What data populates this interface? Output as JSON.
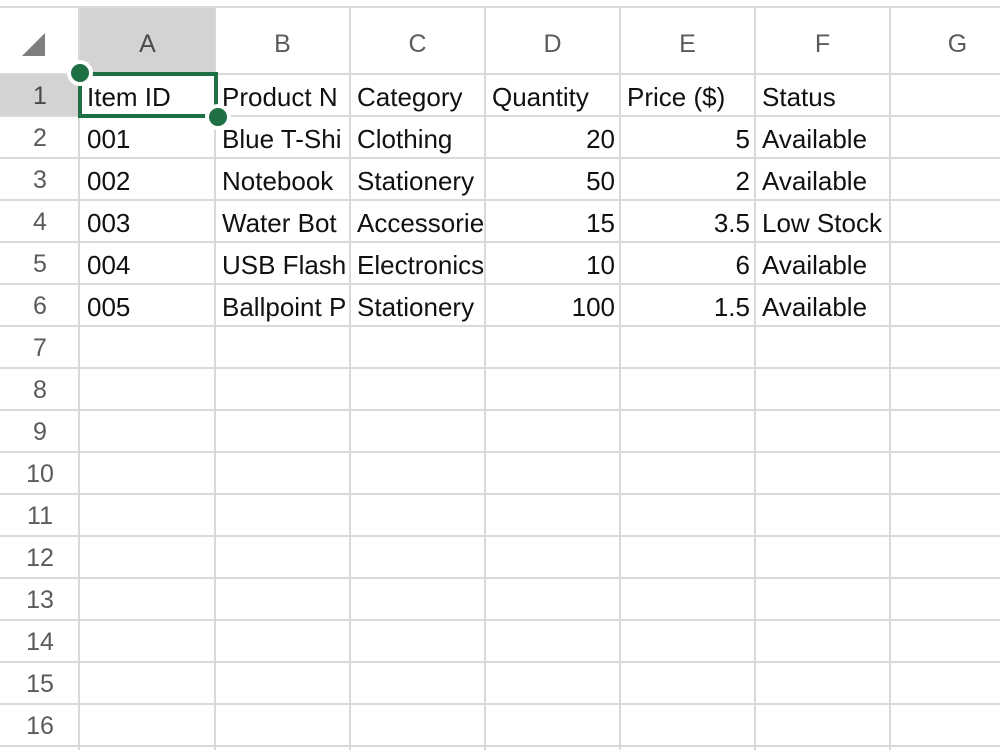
{
  "columns": [
    "A",
    "B",
    "C",
    "D",
    "E",
    "F",
    "G"
  ],
  "rows": [
    "1",
    "2",
    "3",
    "4",
    "5",
    "6",
    "7",
    "8",
    "9",
    "10",
    "11",
    "12",
    "13",
    "14",
    "15",
    "16"
  ],
  "cells": {
    "A1": "Item ID",
    "B1": "Product N",
    "C1": "Category",
    "D1": "Quantity",
    "E1": "Price ($)",
    "F1": "Status",
    "A2": "001",
    "B2": "Blue T-Shi",
    "C2": "Clothing",
    "D2": "20",
    "E2": "5",
    "F2": "Available",
    "A3": "002",
    "B3": "Notebook",
    "C3": "Stationery",
    "D3": "50",
    "E3": "2",
    "F3": "Available",
    "A4": "003",
    "B4": "Water Bot",
    "C4": "Accessorie",
    "D4": "15",
    "E4": "3.5",
    "F4": "Low Stock",
    "A5": "004",
    "B5": "USB Flash",
    "C5": "Electronics",
    "D5": "10",
    "E5": "6",
    "F5": "Available",
    "A6": "005",
    "B6": "Ballpoint P",
    "C6": "Stationery",
    "D6": "100",
    "E6": "1.5",
    "F6": "Available"
  },
  "selection": {
    "cell": "A1"
  },
  "colors": {
    "selection": "#1e6f43",
    "header_selected": "#d3d3d3",
    "gridline": "#d9d9d9"
  }
}
